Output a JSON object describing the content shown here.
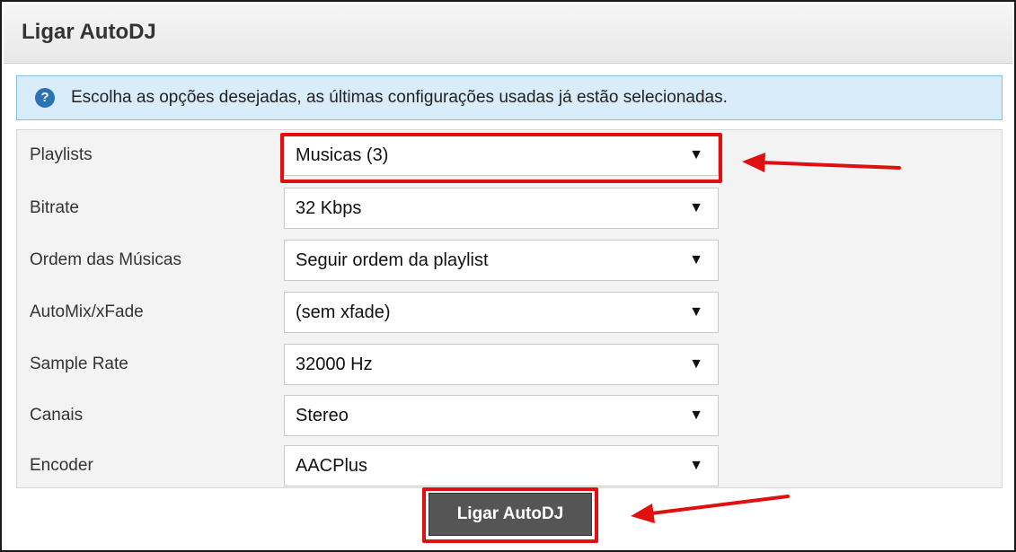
{
  "panel": {
    "title": "Ligar AutoDJ"
  },
  "info": {
    "icon": "question-circle-icon",
    "icon_glyph": "?",
    "text": "Escolha as opções desejadas, as últimas configurações usadas já estão selecionadas."
  },
  "form": {
    "arrow_glyph": "▼",
    "fields": [
      {
        "label": "Playlists",
        "value": "Musicas (3)"
      },
      {
        "label": "Bitrate",
        "value": "32 Kbps"
      },
      {
        "label": "Ordem das Músicas",
        "value": "Seguir ordem da playlist"
      },
      {
        "label": "AutoMix/xFade",
        "value": "(sem xfade)"
      },
      {
        "label": "Sample Rate",
        "value": "32000 Hz"
      },
      {
        "label": "Canais",
        "value": "Stereo"
      },
      {
        "label": "Encoder",
        "value": "AACPlus"
      }
    ]
  },
  "submit_label": "Ligar AutoDJ",
  "colors": {
    "highlight": "#e01010",
    "info_background": "#d9ecfa",
    "info_border": "#87bde4",
    "button_background": "#555555"
  }
}
